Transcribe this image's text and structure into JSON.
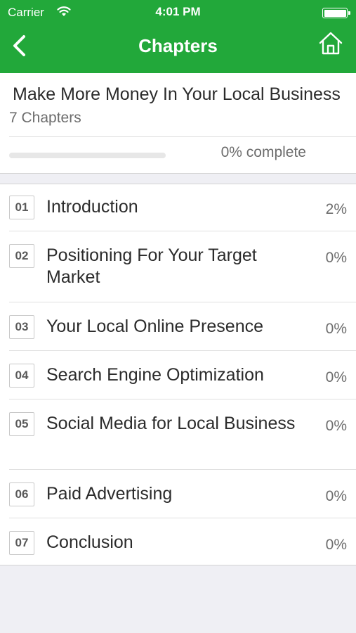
{
  "status_bar": {
    "carrier": "Carrier",
    "time": "4:01 PM"
  },
  "nav": {
    "title": "Chapters",
    "back_icon": "chevron-left-icon",
    "home_icon": "home-icon"
  },
  "course": {
    "title": "Make More Money In Your Local Business",
    "chapter_count": "7 Chapters",
    "progress_value": 0,
    "progress_label": "0% complete"
  },
  "chapters": [
    {
      "number": "01",
      "title": "Introduction",
      "percent": "2%"
    },
    {
      "number": "02",
      "title": "Positioning For Your Target Market",
      "percent": "0%"
    },
    {
      "number": "03",
      "title": "Your Local Online Presence",
      "percent": "0%"
    },
    {
      "number": "04",
      "title": "Search Engine Optimization",
      "percent": "0%"
    },
    {
      "number": "05",
      "title": "Social Media for Local Business",
      "percent": "0%"
    },
    {
      "number": "06",
      "title": "Paid Advertising",
      "percent": "0%"
    },
    {
      "number": "07",
      "title": "Conclusion",
      "percent": "0%"
    }
  ],
  "colors": {
    "accent": "#22a83a"
  }
}
